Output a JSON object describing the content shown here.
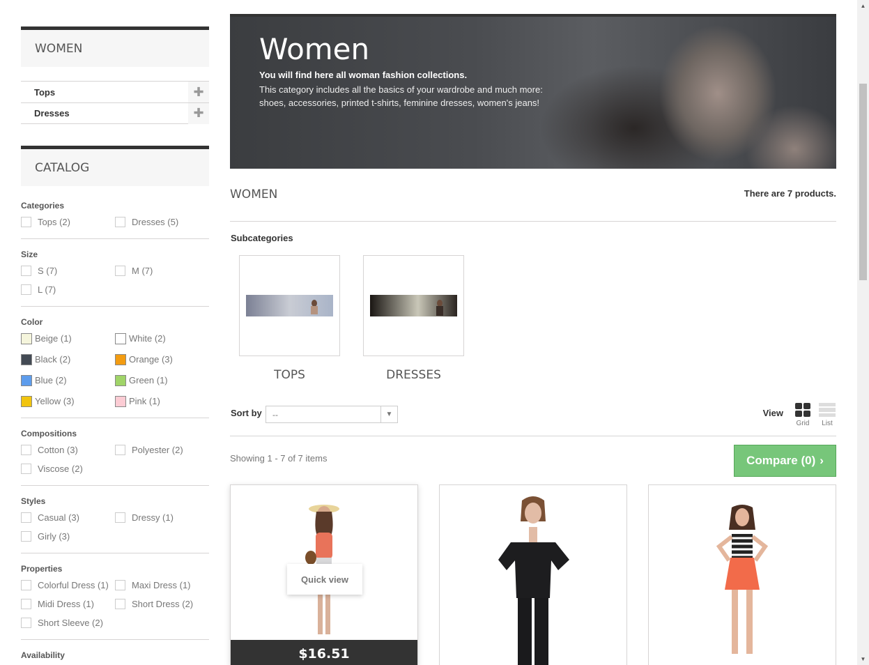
{
  "women_block": {
    "title": "WOMEN",
    "items": [
      {
        "label": "Tops"
      },
      {
        "label": "Dresses"
      }
    ]
  },
  "catalog_block": {
    "title": "CATALOG",
    "groups": {
      "categories": {
        "title": "Categories",
        "options": [
          "Tops (2)",
          "Dresses (5)"
        ]
      },
      "size": {
        "title": "Size",
        "options": [
          "S (7)",
          "M (7)",
          "L (7)"
        ]
      },
      "color": {
        "title": "Color",
        "options": [
          {
            "label": "Beige (1)",
            "color": "#f5f5dc"
          },
          {
            "label": "White (2)",
            "color": "#ffffff"
          },
          {
            "label": "Black (2)",
            "color": "#434a54"
          },
          {
            "label": "Orange (3)",
            "color": "#f39c11"
          },
          {
            "label": "Blue (2)",
            "color": "#5d9cec"
          },
          {
            "label": "Green (1)",
            "color": "#a0d468"
          },
          {
            "label": "Yellow (3)",
            "color": "#f1c40f"
          },
          {
            "label": "Pink (1)",
            "color": "#fcccd4"
          }
        ]
      },
      "compositions": {
        "title": "Compositions",
        "options": [
          "Cotton (3)",
          "Polyester (2)",
          "Viscose (2)"
        ]
      },
      "styles": {
        "title": "Styles",
        "options": [
          "Casual (3)",
          "Dressy (1)",
          "Girly (3)"
        ]
      },
      "properties": {
        "title": "Properties",
        "options": [
          "Colorful Dress (1)",
          "Maxi Dress (1)",
          "Midi Dress (1)",
          "Short Dress (2)",
          "Short Sleeve (2)"
        ]
      },
      "availability": {
        "title": "Availability"
      }
    }
  },
  "banner": {
    "title": "Women",
    "lead": "You will find here all woman fashion collections.",
    "desc": "This category includes all the basics of your wardrobe and much more: shoes, accessories, printed t-shirts, feminine dresses, women's jeans!"
  },
  "category": {
    "title": "WOMEN",
    "count": "There are 7 products."
  },
  "subcategories": {
    "heading": "Subcategories",
    "items": [
      {
        "name": "TOPS"
      },
      {
        "name": "DRESSES"
      }
    ]
  },
  "sort": {
    "label": "Sort by",
    "value": "--"
  },
  "view": {
    "label": "View",
    "grid": "Grid",
    "list": "List",
    "active": "grid"
  },
  "listing": {
    "showing": "Showing 1 - 7 of 7 items",
    "compare": "Compare (0)"
  },
  "products": [
    {
      "price": "$16.51",
      "quick_view": "Quick view"
    },
    {},
    {}
  ],
  "colors": {
    "accent_green": "#77c67a",
    "dark": "#333333",
    "border": "#d6d4d4"
  }
}
